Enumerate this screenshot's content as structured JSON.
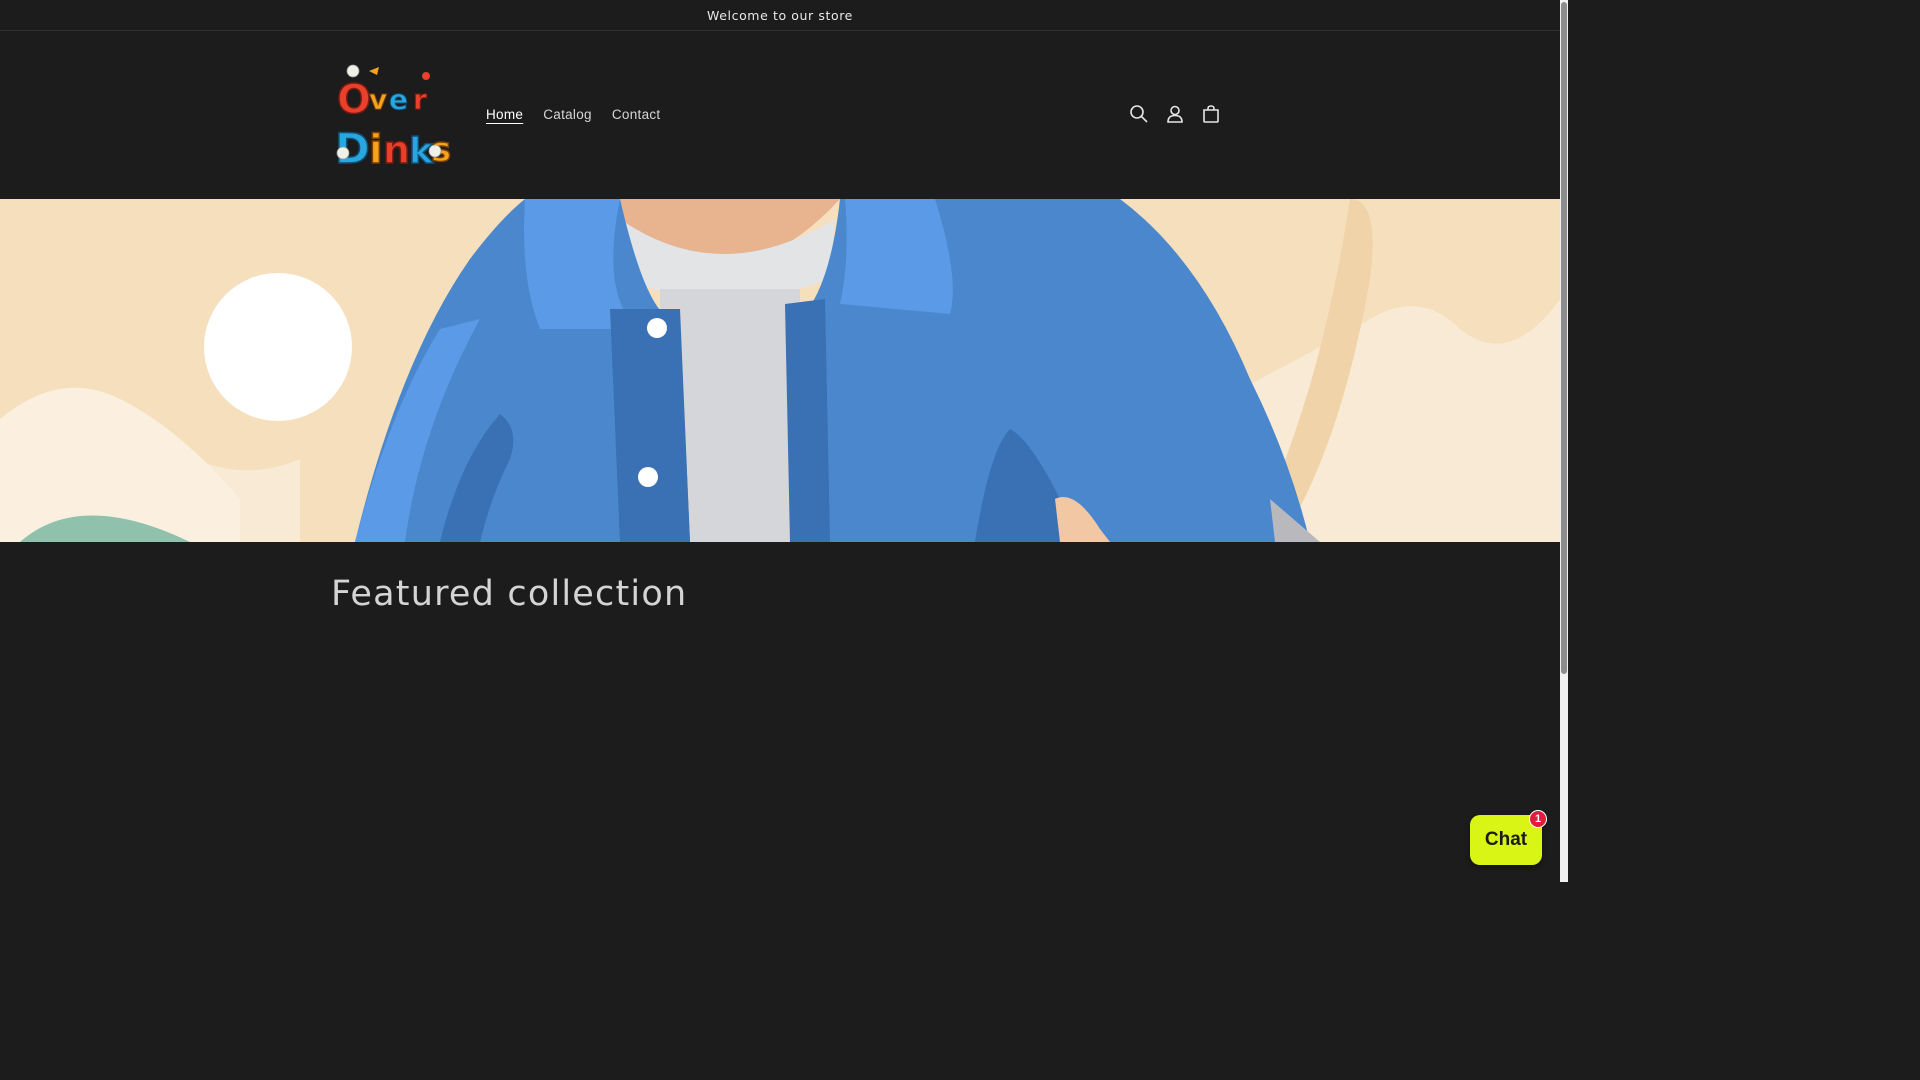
{
  "announcement": {
    "text": "Welcome to our store"
  },
  "header": {
    "logo_alt": "OverDinks",
    "nav": [
      {
        "label": "Home",
        "active": true
      },
      {
        "label": "Catalog",
        "active": false
      },
      {
        "label": "Contact",
        "active": false
      }
    ],
    "icons": [
      "search-icon",
      "account-icon",
      "cart-icon"
    ]
  },
  "hero": {
    "colors": {
      "background": "#f5dfbc",
      "jacket": "#4a87cc",
      "shirt": "#d5d6da",
      "sun": "#ffffff"
    }
  },
  "featured": {
    "title": "Featured collection"
  },
  "chat": {
    "label": "Chat",
    "badge": "1",
    "color": "#d9f515"
  }
}
